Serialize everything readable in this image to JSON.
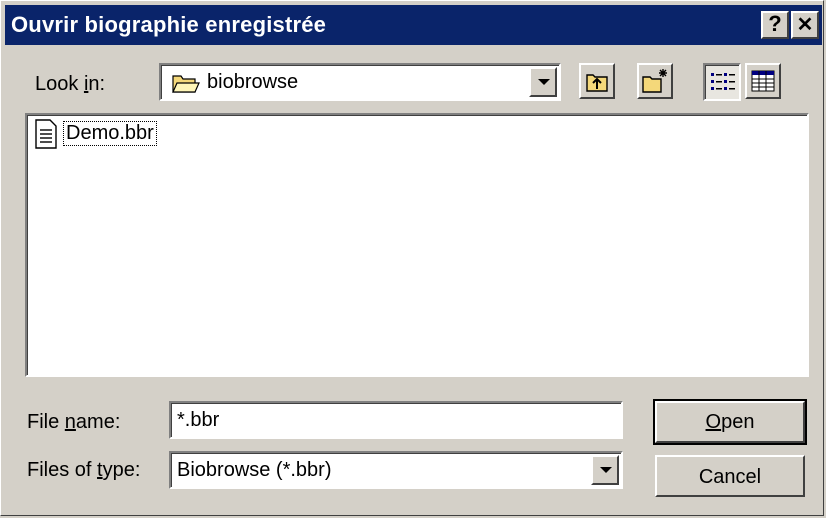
{
  "window": {
    "title": "Ouvrir biographie enregistrée",
    "help_label": "?",
    "close_label": "✕"
  },
  "look_in": {
    "label_prefix": "Look ",
    "label_accel": "i",
    "label_suffix": "n:",
    "value": "biobrowse",
    "icon": "folder-open-icon"
  },
  "toolbar": {
    "up_icon": "up-one-level-icon",
    "new_folder_icon": "new-folder-icon",
    "list_view_icon": "list-view-icon",
    "details_view_icon": "details-view-icon"
  },
  "files": [
    {
      "name": "Demo.bbr",
      "icon": "document-icon"
    }
  ],
  "file_name": {
    "label_prefix": "File ",
    "label_accel": "n",
    "label_suffix": "ame:",
    "value": "*.bbr"
  },
  "file_type": {
    "label_prefix": "Files of ",
    "label_accel": "t",
    "label_suffix": "ype:",
    "value": "Biobrowse (*.bbr)"
  },
  "buttons": {
    "open_accel": "O",
    "open_rest": "pen",
    "cancel": "Cancel"
  }
}
